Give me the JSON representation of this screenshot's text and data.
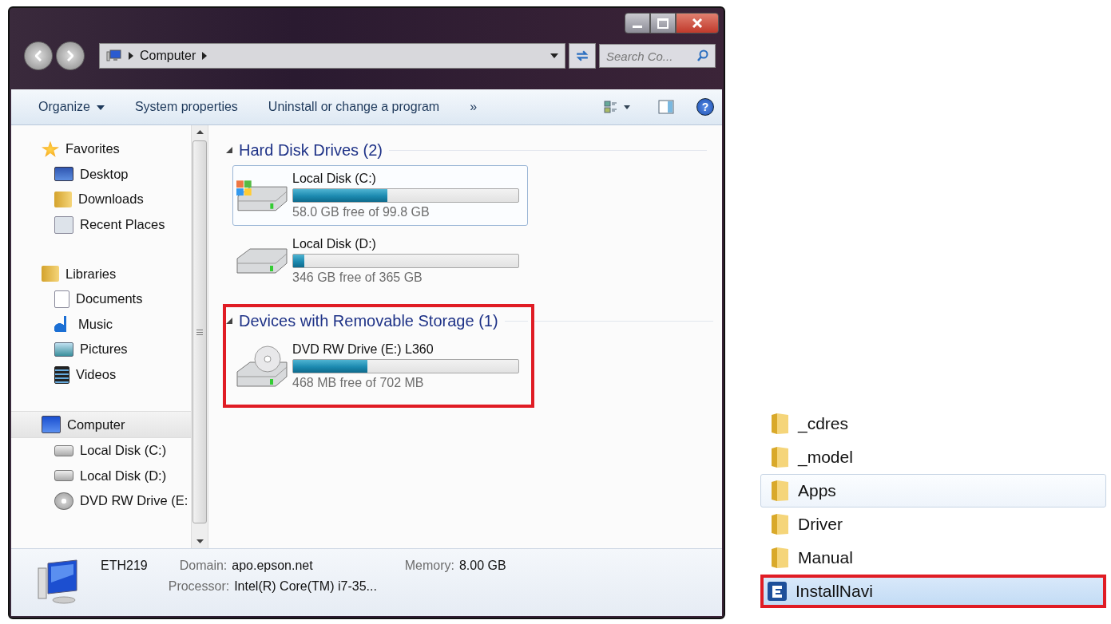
{
  "explorer": {
    "address": {
      "path": "Computer"
    },
    "search": {
      "placeholder": "Search Co..."
    },
    "toolbar": [
      {
        "label": "Organize",
        "dropdown": true
      },
      {
        "label": "System properties",
        "dropdown": false
      },
      {
        "label": "Uninstall or change a program",
        "dropdown": false
      },
      {
        "label": "»",
        "dropdown": false
      }
    ],
    "help": {
      "label": "?"
    },
    "sidebar": [
      {
        "label": "Favorites",
        "selected": false,
        "children": [
          {
            "label": "Desktop",
            "selected": false
          },
          {
            "label": "Downloads",
            "selected": false
          },
          {
            "label": "Recent Places",
            "selected": false
          }
        ]
      },
      {
        "label": "Libraries",
        "selected": false,
        "children": [
          {
            "label": "Documents",
            "selected": false
          },
          {
            "label": "Music",
            "selected": false
          },
          {
            "label": "Pictures",
            "selected": false
          },
          {
            "label": "Videos",
            "selected": false
          }
        ]
      },
      {
        "label": "Computer",
        "selected": true,
        "children": [
          {
            "label": "Local Disk (C:)",
            "selected": false
          },
          {
            "label": "Local Disk (D:)",
            "selected": false
          },
          {
            "label": "DVD RW Drive (E:",
            "selected": false
          }
        ]
      }
    ],
    "groups": [
      {
        "title": "Hard Disk Drives (2)",
        "highlighted": false,
        "drives": [
          {
            "kind": "system",
            "name": "Local Disk (C:)",
            "level": 0.42,
            "free": "58.0 GB free of 99.8 GB",
            "selected": true
          },
          {
            "kind": "disk",
            "name": "Local Disk (D:)",
            "level": 0.05,
            "free": "346 GB free of 365 GB",
            "selected": false
          }
        ]
      },
      {
        "title": "Devices with Removable Storage (1)",
        "highlighted": true,
        "drives": [
          {
            "kind": "dvd",
            "name": "DVD RW Drive (E:) L360",
            "level": 0.33,
            "free": "468 MB free of 702 MB",
            "selected": false
          }
        ]
      }
    ],
    "details": {
      "name": "ETH219",
      "fields": [
        {
          "label": "Domain:",
          "value": "apo.epson.net"
        },
        {
          "label": "Memory:",
          "value": "8.00 GB"
        },
        {
          "label": "Processor:",
          "value": "Intel(R) Core(TM) i7-35..."
        }
      ]
    }
  },
  "files": [
    {
      "kind": "folder",
      "name": "_cdres",
      "hovered": false,
      "selected": false,
      "highlighted": false
    },
    {
      "kind": "folder",
      "name": "_model",
      "hovered": false,
      "selected": false,
      "highlighted": false
    },
    {
      "kind": "folder",
      "name": "Apps",
      "hovered": true,
      "selected": false,
      "highlighted": false
    },
    {
      "kind": "folder",
      "name": "Driver",
      "hovered": false,
      "selected": false,
      "highlighted": false
    },
    {
      "kind": "folder",
      "name": "Manual",
      "hovered": false,
      "selected": false,
      "highlighted": false
    },
    {
      "kind": "app",
      "name": "InstallNavi",
      "hovered": false,
      "selected": true,
      "highlighted": true
    }
  ]
}
